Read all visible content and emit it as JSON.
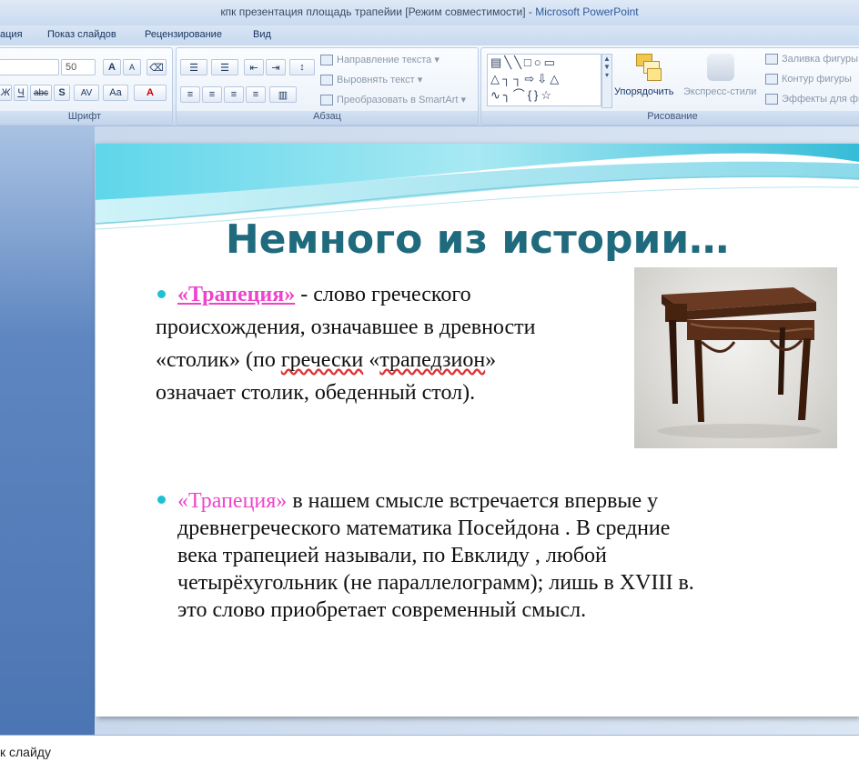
{
  "window": {
    "title": "кпк презентация площадь трапейии [Режим совместимости]",
    "separator": " - ",
    "app_name": "Microsoft PowerPoint"
  },
  "ribbon": {
    "tabs": [
      "ация",
      "Показ слайдов",
      "Рецензирование",
      "Вид"
    ],
    "font_group": {
      "label": "Шрифт",
      "font_size": "50",
      "buttons": [
        "A",
        "A",
        "Ж",
        "Ч",
        "abc",
        "S",
        "AV",
        "Aa",
        "A"
      ]
    },
    "paragraph_group": {
      "label": "Абзац",
      "text_direction": "Направление текста",
      "align_text": "Выровнять текст",
      "convert_smartart": "Преобразовать в SmartArt"
    },
    "drawing_group": {
      "label": "Рисование",
      "arrange": "Упорядочить",
      "quick_styles": "Экспресс-стили",
      "shape_fill": "Заливка фигуры",
      "shape_outline": "Контур фигуры",
      "shape_effects": "Эффекты для фи"
    }
  },
  "slide": {
    "title": "Немного из истории…",
    "p1": {
      "term": "«Трапеция»",
      "l1": " - слово греческого",
      "l2": "происхождения, означавшее в древности",
      "l3a": "«столик» (по ",
      "l3b": "гречески",
      "l3c": " «",
      "l3d": "трапедзион",
      "l3e": "»",
      "l4": "означает столик, обеденный стол)."
    },
    "p2": {
      "term": " «Трапеция»",
      "l1": " в нашем смысле встречается впервые у",
      "l2": "древнегреческого математика Посейдона . В средние",
      "l3": "века трапецией называли, по Евклиду , любой",
      "l4": "четырёхугольник (не параллелограмм); лишь в XVIII в.",
      "l5": "это слово приобретает современный смысл."
    },
    "accent_color": "#1fc1d1",
    "title_color": "#1f6b7d",
    "highlight_color": "#ee44cc"
  },
  "notes": {
    "text": "к слайду"
  }
}
